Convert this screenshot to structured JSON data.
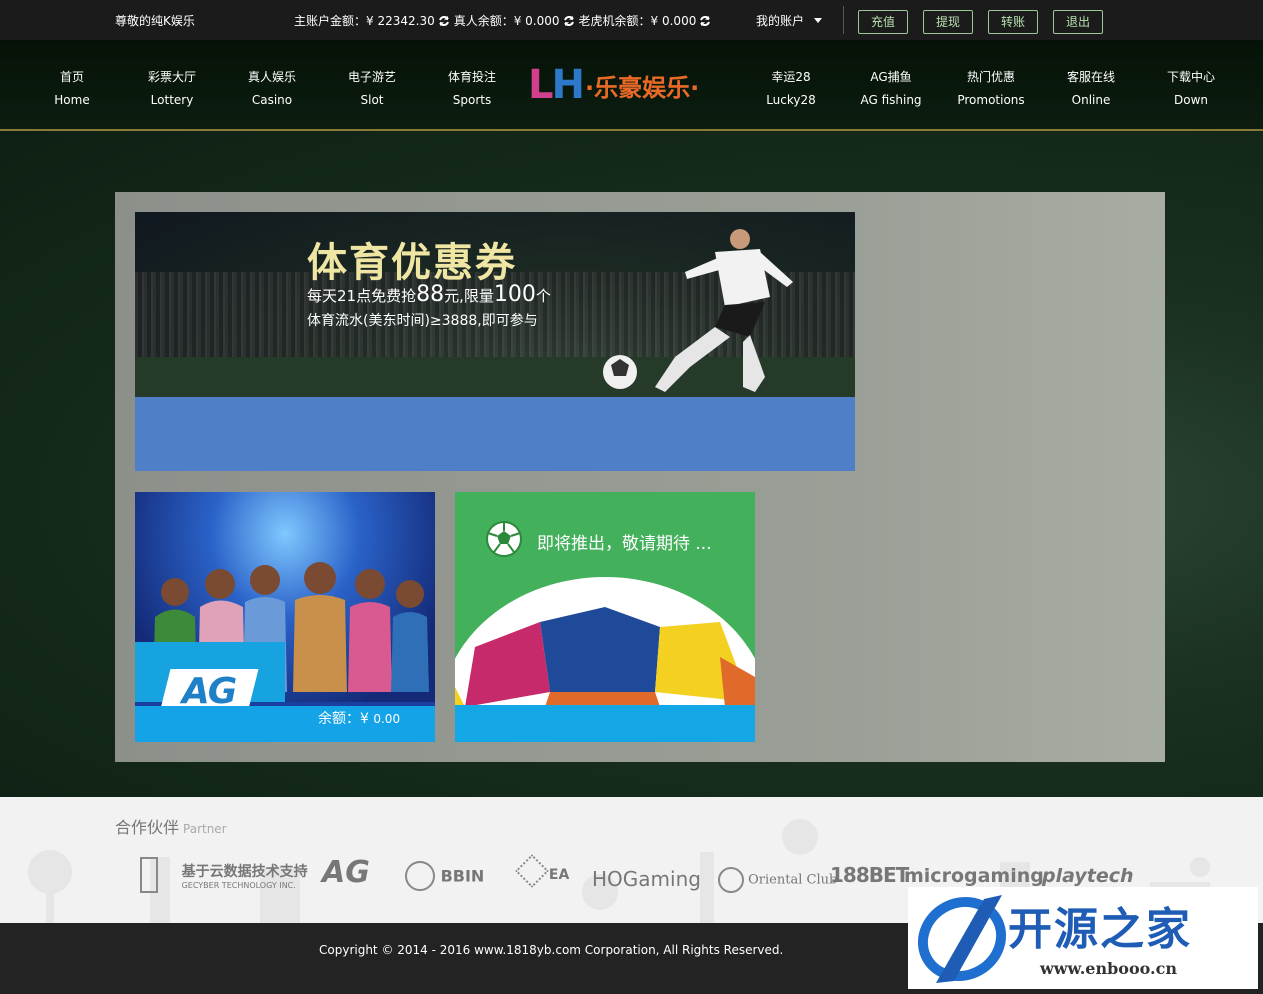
{
  "topbar": {
    "greeting": "尊敬的纯K娱乐",
    "balances": [
      {
        "label": "主账户金额：¥ 22342.30"
      },
      {
        "label": "真人余额：¥ 0.000"
      },
      {
        "label": "老虎机余额：¥ 0.000"
      }
    ],
    "account_label": "我的账户",
    "buttons": [
      "充值",
      "提现",
      "转账",
      "退出"
    ],
    "colors": {
      "bar_bg": "#1b1b1b",
      "button_border": "#9fc59a",
      "button_text": "#b9e0b0"
    }
  },
  "nav": {
    "left": [
      {
        "cn": "首页",
        "en": "Home"
      },
      {
        "cn": "彩票大厅",
        "en": "Lottery"
      },
      {
        "cn": "真人娱乐",
        "en": "Casino"
      },
      {
        "cn": "电子游艺",
        "en": "Slot"
      },
      {
        "cn": "体育投注",
        "en": "Sports"
      }
    ],
    "right": [
      {
        "cn": "幸运28",
        "en": "Lucky28"
      },
      {
        "cn": "AG捕鱼",
        "en": "AG fishing"
      },
      {
        "cn": "热门优惠",
        "en": "Promotions"
      },
      {
        "cn": "客服在线",
        "en": "Online"
      },
      {
        "cn": "下载中心",
        "en": "Down"
      }
    ],
    "logo": {
      "l": "L",
      "h": "H",
      "text": "·乐豪娱乐·"
    }
  },
  "banner": {
    "title": "体育优惠券",
    "line1_a": "每天21点免费抢",
    "line1_b": "88",
    "line1_c": "元,限量",
    "line1_d": "100",
    "line1_e": "个",
    "line2": "体育流水(美东时间)≥3888,即可参与"
  },
  "tiles": {
    "ag": {
      "logo": "AG",
      "balance_label": "余额：¥ ",
      "balance_value": "0.00"
    },
    "soon": {
      "message": "即将推出，敬请期待 ..."
    }
  },
  "partners": {
    "title": "合作伙伴",
    "subtitle": "Partner",
    "logos": [
      "基于云数据技术支持",
      "GECYBER TECHNOLOGY INC.",
      "AG",
      "BBIN",
      "EA",
      "HOGaming",
      "Oriental Club",
      "188BET",
      "microgaming",
      "playtech"
    ]
  },
  "footer": {
    "copyright": "Copyright © 2014 - 2016 www.1818yb.com Corporation, All Rights Reserved."
  },
  "watermark": {
    "title": "开源之家",
    "url": "www.enbooo.cn"
  }
}
